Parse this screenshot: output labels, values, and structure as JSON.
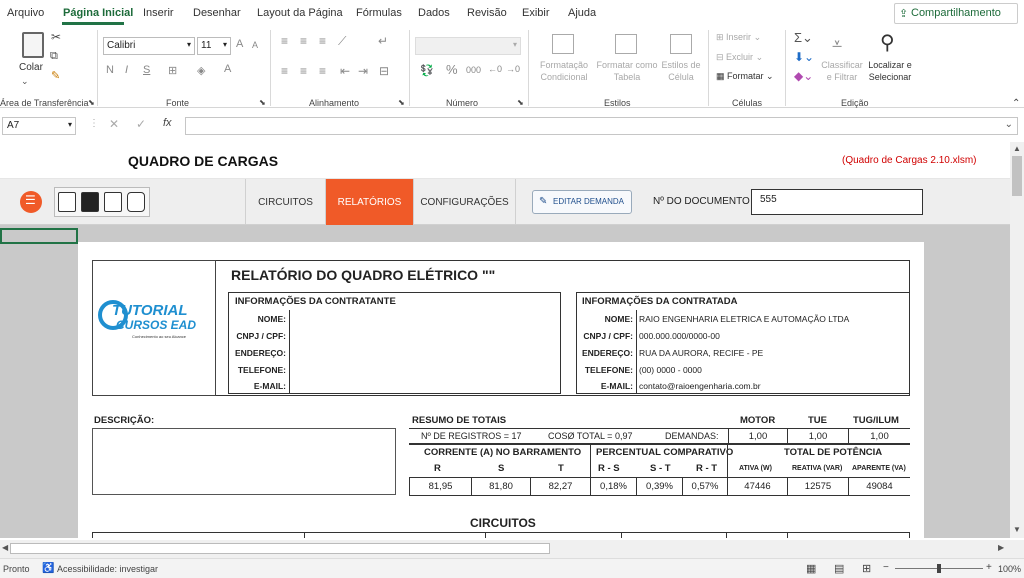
{
  "menu": {
    "items": [
      "Arquivo",
      "Página Inicial",
      "Inserir",
      "Desenhar",
      "Layout da Página",
      "Fórmulas",
      "Dados",
      "Revisão",
      "Exibir",
      "Ajuda"
    ],
    "share_label": "Compartilhamento"
  },
  "ribbon": {
    "clipboard": {
      "paste_label": "Colar",
      "group": "Área de Transferência"
    },
    "font": {
      "name": "Calibri",
      "size": "11",
      "group": "Fonte",
      "bold": "N",
      "italic": "I",
      "underline": "S"
    },
    "alignment": {
      "group": "Alinhamento"
    },
    "number": {
      "group": "Número",
      "percent": "%",
      "thousands": "000"
    },
    "styles": {
      "conditional": "Formatação Condicional",
      "table": "Formatar como Tabela",
      "cell_styles": "Estilos de Célula",
      "group": "Estilos"
    },
    "cells": {
      "insert": "Inserir",
      "delete": "Excluir",
      "format": "Formatar",
      "group": "Células"
    },
    "editing": {
      "sort": "Classificar e Filtrar",
      "find": "Localizar e Selecionar",
      "group": "Edição"
    }
  },
  "formula_bar": {
    "name_box": "A7",
    "fx": "fx",
    "formula": ""
  },
  "sheet": {
    "title": "QUADRO DE CARGAS",
    "file_note": "(Quadro de Cargas 2.10.xlsm)",
    "tabs": [
      "CIRCUITOS",
      "RELATÓRIOS",
      "CONFIGURAÇÕES"
    ],
    "active_tab": "RELATÓRIOS",
    "edit_button": "EDITAR DEMANDA",
    "doc_label": "Nº DO DOCUMENTO",
    "doc_number": "555"
  },
  "report": {
    "title": "RELATÓRIO DO QUADRO ELÉTRICO \"\"",
    "logo": {
      "line1": "TUTORIAL",
      "line2": "CURSOS EAD",
      "tagline": "Conhecimento ao seu Alcance"
    },
    "contratante": {
      "header": "INFORMAÇÕES DA CONTRATANTE",
      "labels": [
        "NOME:",
        "CNPJ / CPF:",
        "ENDEREÇO:",
        "TELEFONE:",
        "E-MAIL:"
      ],
      "values": [
        "",
        "",
        "",
        "",
        ""
      ]
    },
    "contratada": {
      "header": "INFORMAÇÕES DA CONTRATADA",
      "labels": [
        "NOME:",
        "CNPJ / CPF:",
        "ENDEREÇO:",
        "TELEFONE:",
        "E-MAIL:"
      ],
      "values": [
        "RAIO ENGENHARIA ELETRICA E AUTOMAÇÃO LTDA",
        "000.000.000/0000-00",
        "RUA DA AURORA, RECIFE - PE",
        "(00) 0000 - 0000",
        "contato@raioengenharia.com.br"
      ]
    },
    "descricao_label": "DESCRIÇÃO:",
    "resumo": {
      "header": "RESUMO DE TOTAIS",
      "registros": "Nº DE REGISTROS = 17",
      "cos": "COSØ TOTAL = 0,97",
      "demandas_label": "DEMANDAS:",
      "motor_label": "MOTOR",
      "tue_label": "TUE",
      "tug_label": "TUG/ILUM",
      "motor": "1,00",
      "tue": "1,00",
      "tug": "1,00",
      "corrente_header": "CORRENTE (A) NO BARRAMENTO",
      "phases": [
        "R",
        "S",
        "T"
      ],
      "corrente": [
        "81,95",
        "81,80",
        "82,27"
      ],
      "percentual_header": "PERCENTUAL COMPARATIVO",
      "pairs": [
        "R - S",
        "S - T",
        "R - T"
      ],
      "percentual": [
        "0,18%",
        "0,39%",
        "0,57%"
      ],
      "potencia_header": "TOTAL DE POTÊNCIA",
      "potencia_labels": [
        "ATIVA (W)",
        "REATIVA (VAR)",
        "APARENTE (VA)"
      ],
      "potencia": [
        "47446",
        "12575",
        "49084"
      ]
    },
    "circuitos_title": "CIRCUITOS"
  },
  "status": {
    "ready": "Pronto",
    "accessibility": "Acessibilidade: investigar",
    "zoom": "100%"
  }
}
